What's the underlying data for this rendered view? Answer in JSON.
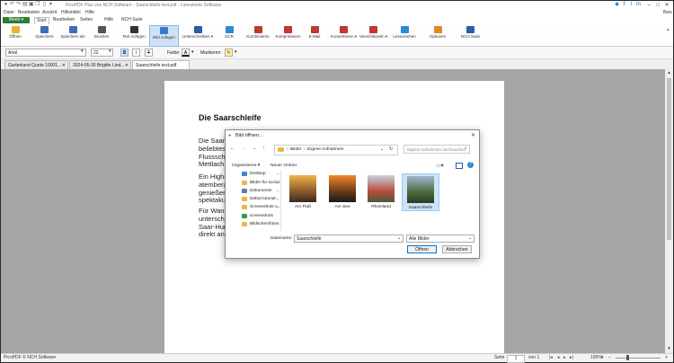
{
  "window": {
    "title": "PicoPDF Plus von NCH Software - Saarschleife text.pdf - Lizenzierte Software",
    "help_label": "Beis"
  },
  "menu": [
    "Datei",
    "Bearbeiten",
    "Ansicht",
    "Hilfsmittel",
    "Hilfe"
  ],
  "ribbon": {
    "menu_button": "Menü",
    "tabs": [
      "Start",
      "Bearbeiten",
      "Seiten",
      "Hilfe",
      "NCH Suite"
    ],
    "active_tab": "Start"
  },
  "toolbar": {
    "items": [
      {
        "label": "Öffnen",
        "icon": "folder-open-icon",
        "color": "#e9b23a"
      },
      {
        "label": "Speichern",
        "icon": "save-icon",
        "color": "#3d6fb6"
      },
      {
        "label": "Speichern als",
        "icon": "save-as-icon",
        "color": "#3d6fb6"
      },
      {
        "label": "Drucken",
        "icon": "print-icon",
        "color": "#555555"
      },
      {
        "label": "Text zufügen",
        "icon": "text-icon",
        "color": "#333333"
      },
      {
        "label": "Bild zufügen",
        "icon": "image-icon",
        "color": "#3a7bc8"
      },
      {
        "label": "Unterschreiben",
        "icon": "signature-icon",
        "color": "#2a5ea8"
      },
      {
        "label": "OCR",
        "icon": "ocr-icon",
        "color": "#2a8bd0"
      },
      {
        "label": "Kombinieren",
        "icon": "combine-icon",
        "color": "#c0392b"
      },
      {
        "label": "Komprimieren",
        "icon": "compress-icon",
        "color": "#c0392b"
      },
      {
        "label": "E-Mail",
        "icon": "email-icon",
        "color": "#c0392b"
      },
      {
        "label": "Konvertieren",
        "icon": "convert-icon",
        "color": "#c0392b"
      },
      {
        "label": "Verschlüsseln",
        "icon": "lock-icon",
        "color": "#c0392b"
      },
      {
        "label": "Lesezeichen",
        "icon": "bookmark-icon",
        "color": "#2a8bd0"
      },
      {
        "label": "Optionen",
        "icon": "gear-icon",
        "color": "#e08a1e"
      },
      {
        "label": "NCH Suite",
        "icon": "nch-suite-icon",
        "color": "#2a5ea8"
      }
    ]
  },
  "format": {
    "font": "Arial",
    "size": "22",
    "bold": "B",
    "italic": "I",
    "strike": "T",
    "color_label": "Farbe:",
    "color_value": "A",
    "highlight_label": "Markieren:"
  },
  "doc_tabs": [
    {
      "label": "Gartenland Quote 10001..."
    },
    {
      "label": "2024-05-30 Brigitte Lind..."
    },
    {
      "label": "Saarschleife text.pdf"
    }
  ],
  "document": {
    "title": "Die Saarschleife",
    "paragraphs": [
      [
        "Die Saarschleife ist eines der",
        "beliebtesten Ausflugsziele",
        "Flussschleife",
        "Mettlach"
      ],
      [
        "Ein Highlight",
        "atemberaubend",
        "genießen",
        "spektakulär"
      ],
      [
        "Für Wanderer",
        "unterschiedlich",
        "Saar-Hunsrück",
        "direkt an"
      ]
    ]
  },
  "dialog": {
    "title": "Bild öffnen...",
    "breadcrumb": [
      "Bilder",
      "Eigene Aufnahmen"
    ],
    "search_placeholder": "Eigene Aufnahmen durchsuchen",
    "organize": "Organisieren",
    "new_folder": "Neuer Ordner",
    "sidebar": [
      {
        "label": "Desktop",
        "icon": "desktop-icon",
        "color": "#3a86d4"
      },
      {
        "label": "Bilder für social",
        "icon": "folder-icon",
        "color": "#e8b84a"
      },
      {
        "label": "Dokumente",
        "icon": "documents-icon",
        "color": "#5b7fa8"
      },
      {
        "label": "Debut tutorial",
        "icon": "folder-icon",
        "color": "#e8b84a"
      },
      {
        "label": "Screenshots v...",
        "icon": "folder-icon",
        "color": "#e8b84a"
      },
      {
        "label": "screenshots",
        "icon": "folder-icon",
        "color": "#2f9e44"
      },
      {
        "label": "Bildschirmfotos",
        "icon": "folder-icon",
        "color": "#e8b84a"
      }
    ],
    "files": [
      {
        "name": "Am Fluß",
        "colors": [
          "#f3b24a",
          "#8a5a2c",
          "#3a2a20"
        ]
      },
      {
        "name": "Am See",
        "colors": [
          "#f08a2a",
          "#6a3a1a",
          "#1a1a1a"
        ]
      },
      {
        "name": "Rheinland",
        "colors": [
          "#c9d3e0",
          "#b64b3b",
          "#4a5a3a"
        ]
      },
      {
        "name": "Saarschleife",
        "colors": [
          "#9fb7d0",
          "#4a6a3a",
          "#2a3a2a"
        ]
      }
    ],
    "selected_file": "Saarschleife",
    "filename_label": "Dateiname:",
    "filename_value": "Saarschleife",
    "filter_value": "Alle Bilder",
    "open_button": "Öffnen",
    "cancel_button": "Abbrechen"
  },
  "status": {
    "app": "PicoPDF © NCH Software",
    "page_label": "Seite",
    "page_value": "1",
    "of_label": "von 1",
    "zoom": "100%"
  }
}
